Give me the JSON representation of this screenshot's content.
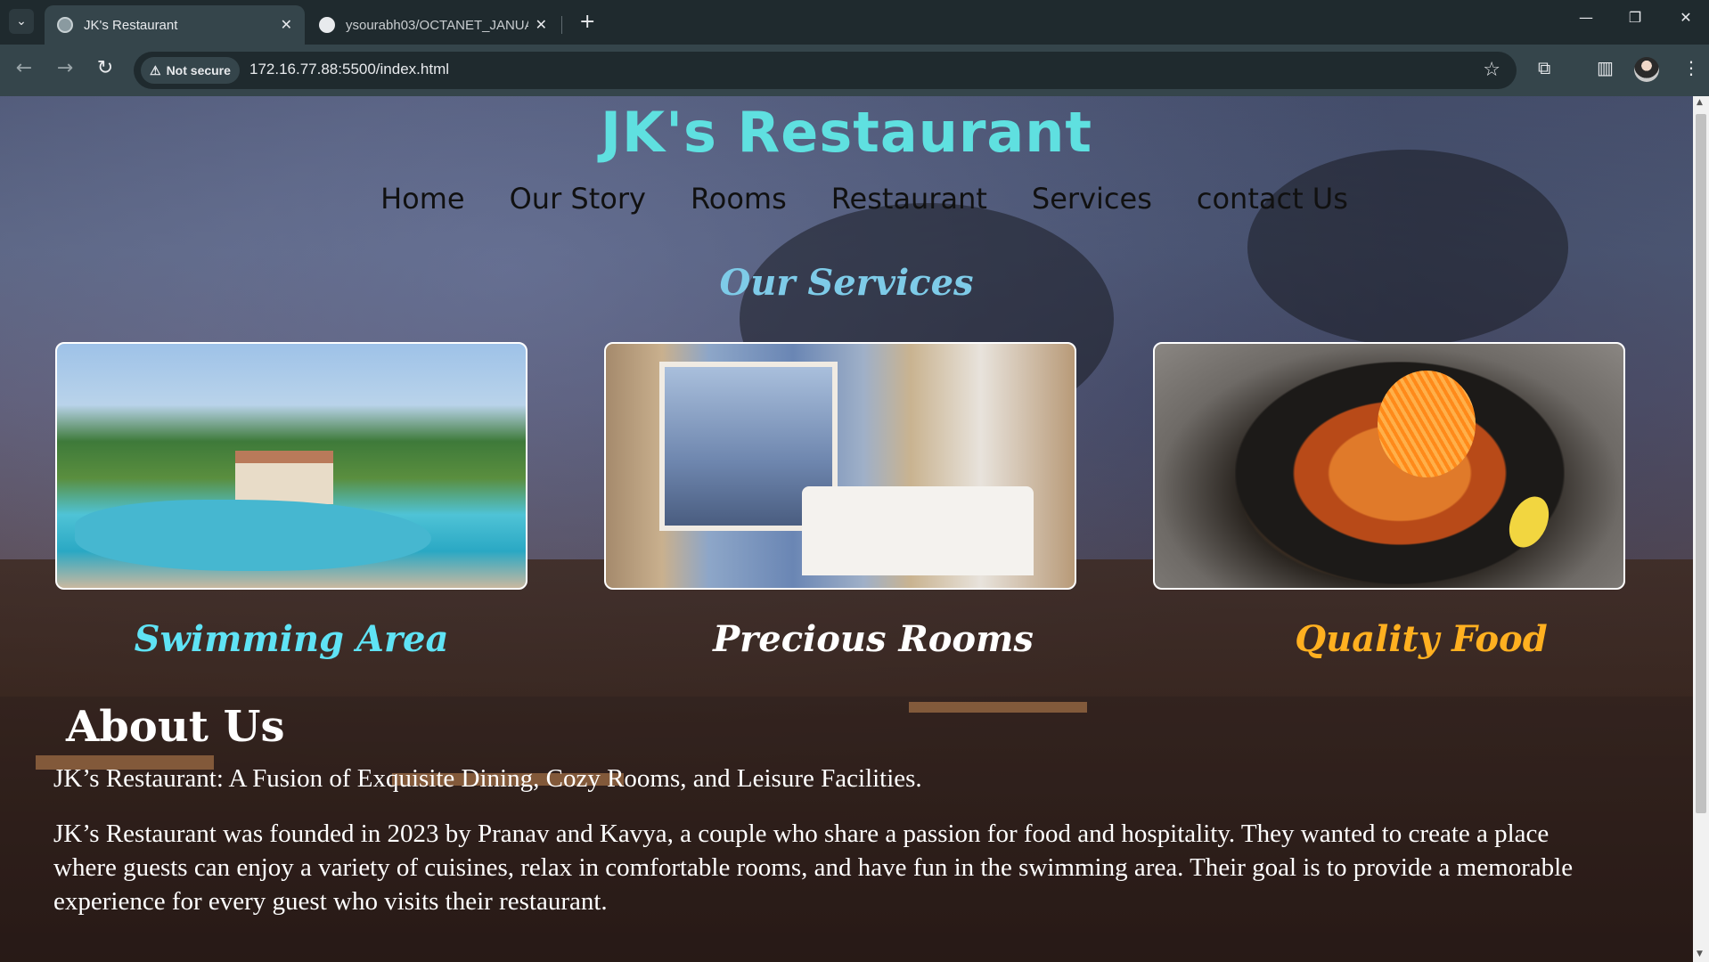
{
  "browser": {
    "tabs": [
      {
        "title": "JK's Restaurant",
        "active": true
      },
      {
        "title": "ysourabh03/OCTANET_JANUAR",
        "active": false
      }
    ],
    "security_label": "Not secure",
    "url": "172.16.77.88:5500/index.html"
  },
  "site": {
    "title": "JK's Restaurant",
    "nav": [
      "Home",
      "Our Story",
      "Rooms",
      "Restaurant",
      "Services",
      "contact Us"
    ]
  },
  "services": {
    "heading": "Our Services",
    "cards": [
      {
        "caption": "Swimming Area",
        "color": "#5fe3f5"
      },
      {
        "caption": "Precious Rooms",
        "color": "#ffffff"
      },
      {
        "caption": "Quality Food",
        "color": "#ffb020"
      }
    ]
  },
  "about": {
    "heading": "About Us",
    "tagline": "JK’s Restaurant: A Fusion of Exquisite Dining, Cozy Rooms, and Leisure Facilities.",
    "story": "JK’s Restaurant was founded in 2023 by Pranav and Kavya, a couple who share a passion for food and hospitality. They wanted to create a place where guests can enjoy a variety of cuisines, relax in comfortable rooms, and have fun in the swimming area. Their goal is to provide a memorable experience for every guest who visits their restaurant."
  }
}
